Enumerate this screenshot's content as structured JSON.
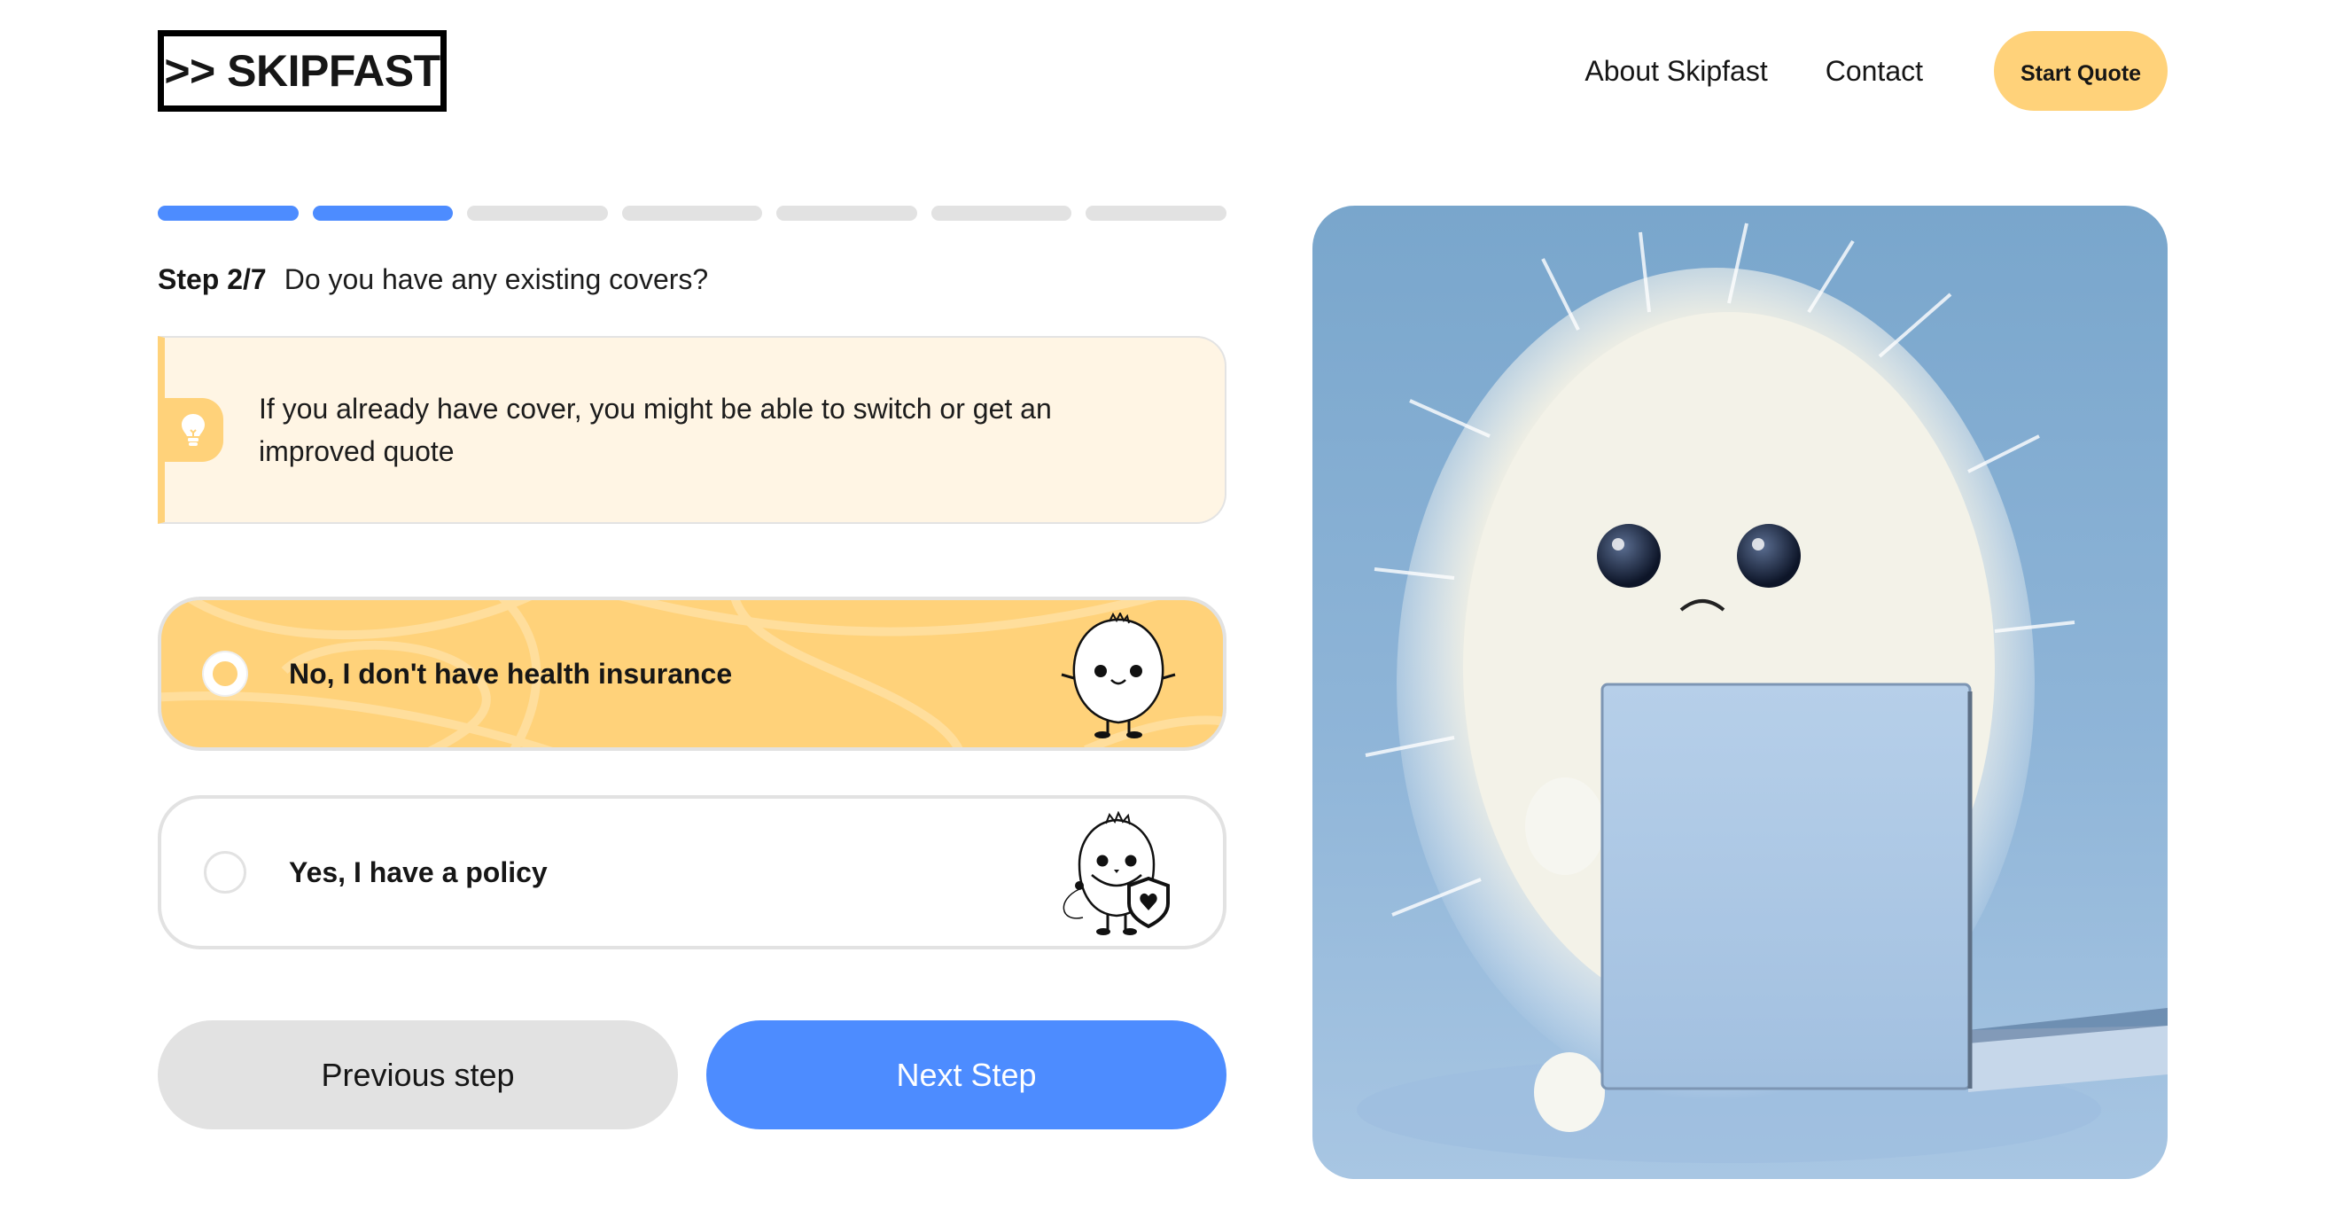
{
  "header": {
    "logo_text": ">> SKIPFAST",
    "nav": [
      {
        "label": "About Skipfast"
      },
      {
        "label": "Contact"
      }
    ],
    "cta_label": "Start Quote"
  },
  "progress": {
    "current_step": 2,
    "total_steps": 7
  },
  "question": {
    "step_label": "Step 2/7",
    "text": "Do you have any existing covers?"
  },
  "tip": {
    "icon": "lightbulb-icon",
    "text": "If you already have cover, you might be able to switch or get an improved quote"
  },
  "options": [
    {
      "label": "No, I don't have health insurance",
      "selected": true,
      "illustration": "happy-fluffy-mascot"
    },
    {
      "label": "Yes, I have a policy",
      "selected": false,
      "illustration": "mascot-with-shield-heart"
    }
  ],
  "actions": {
    "previous_label": "Previous step",
    "next_label": "Next Step"
  },
  "hero_image": {
    "description": "Sad white fluffy creature behind a blue laptop on a blue background"
  },
  "colors": {
    "accent_blue": "#4d8cff",
    "accent_yellow": "#ffd27a",
    "tip_background": "#fff5e4",
    "inactive_gray": "#e2e2e2"
  }
}
